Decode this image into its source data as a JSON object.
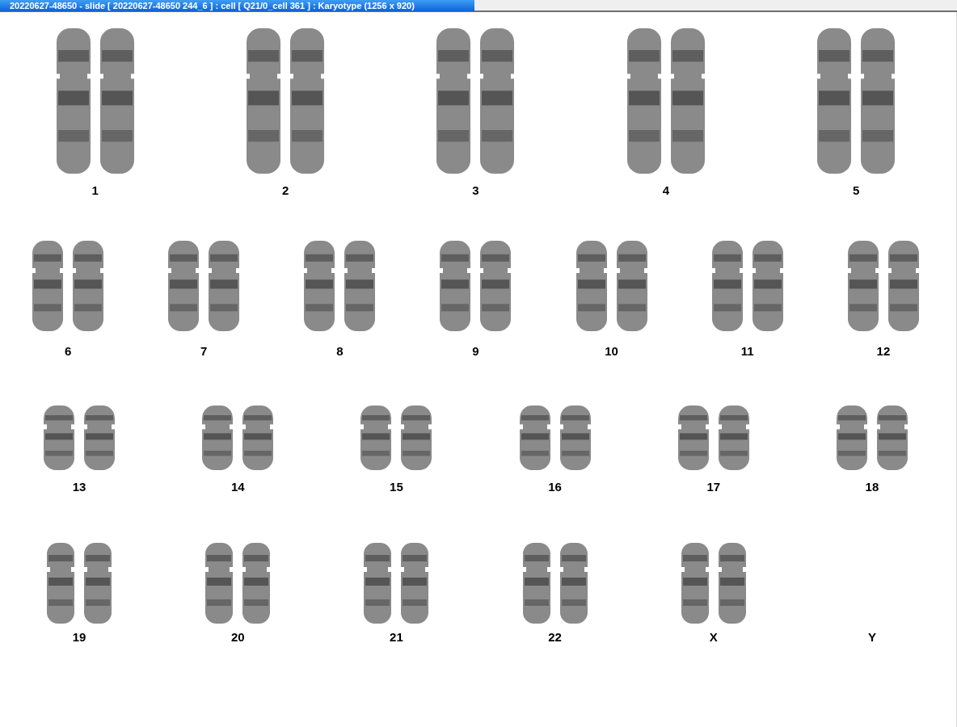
{
  "window": {
    "title": "20220627-48650 - slide [ 20220627-48650 244_6 ] : cell [ Q21/0_cell 361 ] : Karyotype  (1256 x 920)"
  },
  "karyotype": {
    "rows": [
      {
        "items": [
          {
            "label": "1",
            "kind": "pair"
          },
          {
            "label": "2",
            "kind": "pair"
          },
          {
            "label": "3",
            "kind": "pair"
          },
          {
            "label": "4",
            "kind": "pair"
          },
          {
            "label": "5",
            "kind": "pair"
          }
        ]
      },
      {
        "items": [
          {
            "label": "6",
            "kind": "pair"
          },
          {
            "label": "7",
            "kind": "pair"
          },
          {
            "label": "8",
            "kind": "pair"
          },
          {
            "label": "9",
            "kind": "pair"
          },
          {
            "label": "10",
            "kind": "pair"
          },
          {
            "label": "11",
            "kind": "pair"
          },
          {
            "label": "12",
            "kind": "pair"
          }
        ]
      },
      {
        "items": [
          {
            "label": "13",
            "kind": "pair"
          },
          {
            "label": "14",
            "kind": "pair"
          },
          {
            "label": "15",
            "kind": "pair"
          },
          {
            "label": "16",
            "kind": "pair"
          },
          {
            "label": "17",
            "kind": "pair"
          },
          {
            "label": "18",
            "kind": "pair"
          }
        ]
      },
      {
        "items": [
          {
            "label": "19",
            "kind": "pair"
          },
          {
            "label": "20",
            "kind": "pair"
          },
          {
            "label": "21",
            "kind": "pair"
          },
          {
            "label": "22",
            "kind": "pair"
          },
          {
            "label": "X",
            "kind": "pair"
          },
          {
            "label": "Y",
            "kind": "empty"
          }
        ]
      }
    ]
  }
}
